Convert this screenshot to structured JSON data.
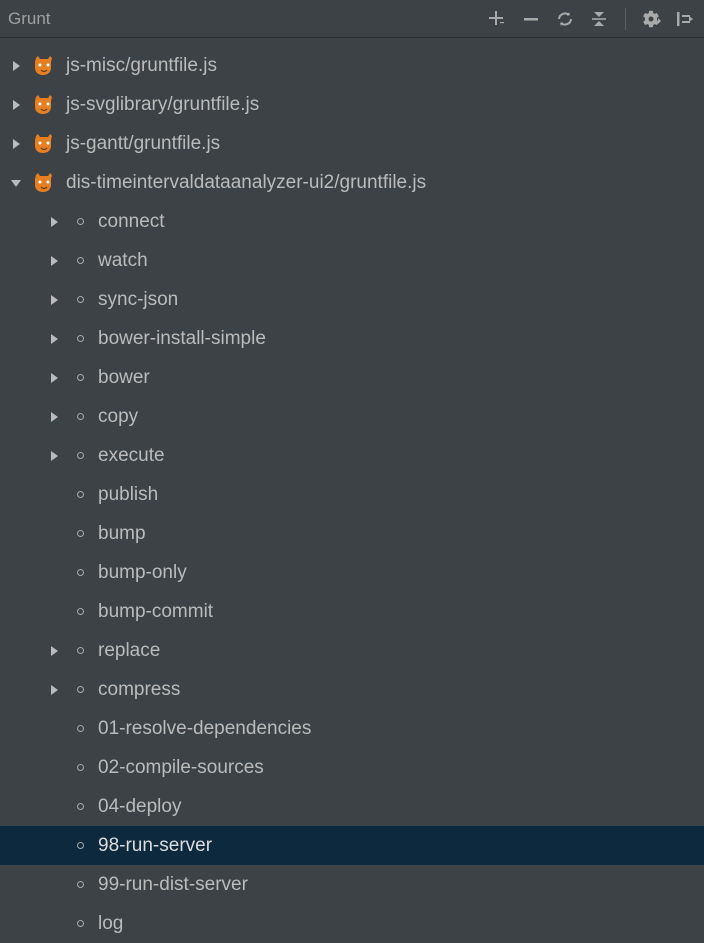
{
  "toolbar": {
    "title": "Grunt"
  },
  "tree": {
    "files": [
      {
        "label": "js-misc/gruntfile.js",
        "expanded": false
      },
      {
        "label": "js-svglibrary/gruntfile.js",
        "expanded": false
      },
      {
        "label": "js-gantt/gruntfile.js",
        "expanded": false
      },
      {
        "label": "dis-timeintervaldataanalyzer-ui2/gruntfile.js",
        "expanded": true
      }
    ],
    "tasks": [
      {
        "label": "connect",
        "expandable": true
      },
      {
        "label": "watch",
        "expandable": true
      },
      {
        "label": "sync-json",
        "expandable": true
      },
      {
        "label": "bower-install-simple",
        "expandable": true
      },
      {
        "label": "bower",
        "expandable": true
      },
      {
        "label": "copy",
        "expandable": true
      },
      {
        "label": "execute",
        "expandable": true
      },
      {
        "label": "publish",
        "expandable": false
      },
      {
        "label": "bump",
        "expandable": false
      },
      {
        "label": "bump-only",
        "expandable": false
      },
      {
        "label": "bump-commit",
        "expandable": false
      },
      {
        "label": "replace",
        "expandable": true
      },
      {
        "label": "compress",
        "expandable": true
      },
      {
        "label": "01-resolve-dependencies",
        "expandable": false
      },
      {
        "label": "02-compile-sources",
        "expandable": false
      },
      {
        "label": "04-deploy",
        "expandable": false
      },
      {
        "label": "98-run-server",
        "expandable": false,
        "selected": true
      },
      {
        "label": "99-run-dist-server",
        "expandable": false
      },
      {
        "label": "log",
        "expandable": false
      }
    ]
  }
}
